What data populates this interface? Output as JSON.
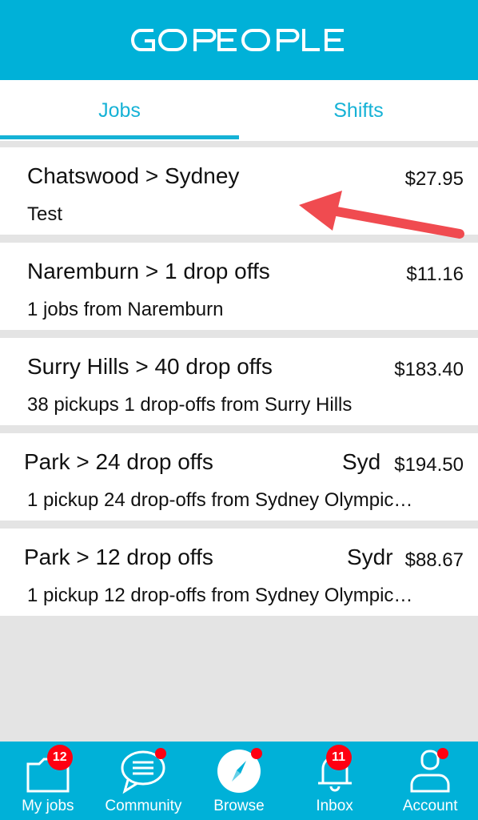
{
  "header": {
    "logo_text": "GOPEOPLE",
    "brand_color": "#00b1d8"
  },
  "tabs": [
    {
      "label": "Jobs",
      "active": true
    },
    {
      "label": "Shifts",
      "active": false
    }
  ],
  "jobs": [
    {
      "title": "Chatswood > Sydney",
      "title_right": "",
      "price": "$27.95",
      "subtitle": "Test"
    },
    {
      "title": "Naremburn > 1 drop offs",
      "title_right": "",
      "price": "$11.16",
      "subtitle": "1 jobs from Naremburn"
    },
    {
      "title": "Surry Hills > 40 drop offs",
      "title_right": "",
      "price": "$183.40",
      "subtitle": "38 pickups 1 drop-offs from Surry Hills"
    },
    {
      "title": "Park > 24 drop offs",
      "title_right": "Syd",
      "price": "$194.50",
      "subtitle": "1 pickup 24 drop-offs from Sydney Olympic…"
    },
    {
      "title": "Park > 12 drop offs",
      "title_right": "Sydr",
      "price": "$88.67",
      "subtitle": "1 pickup 12 drop-offs from Sydney Olympic…"
    }
  ],
  "bottom_nav": [
    {
      "label": "My jobs",
      "icon": "my-jobs-icon",
      "badge": "12"
    },
    {
      "label": "Community",
      "icon": "chat-bubble-icon",
      "badge": ""
    },
    {
      "label": "Browse",
      "icon": "compass-icon",
      "badge": ""
    },
    {
      "label": "Inbox",
      "icon": "bell-icon",
      "badge": "11"
    },
    {
      "label": "Account",
      "icon": "user-icon",
      "badge": ""
    }
  ]
}
